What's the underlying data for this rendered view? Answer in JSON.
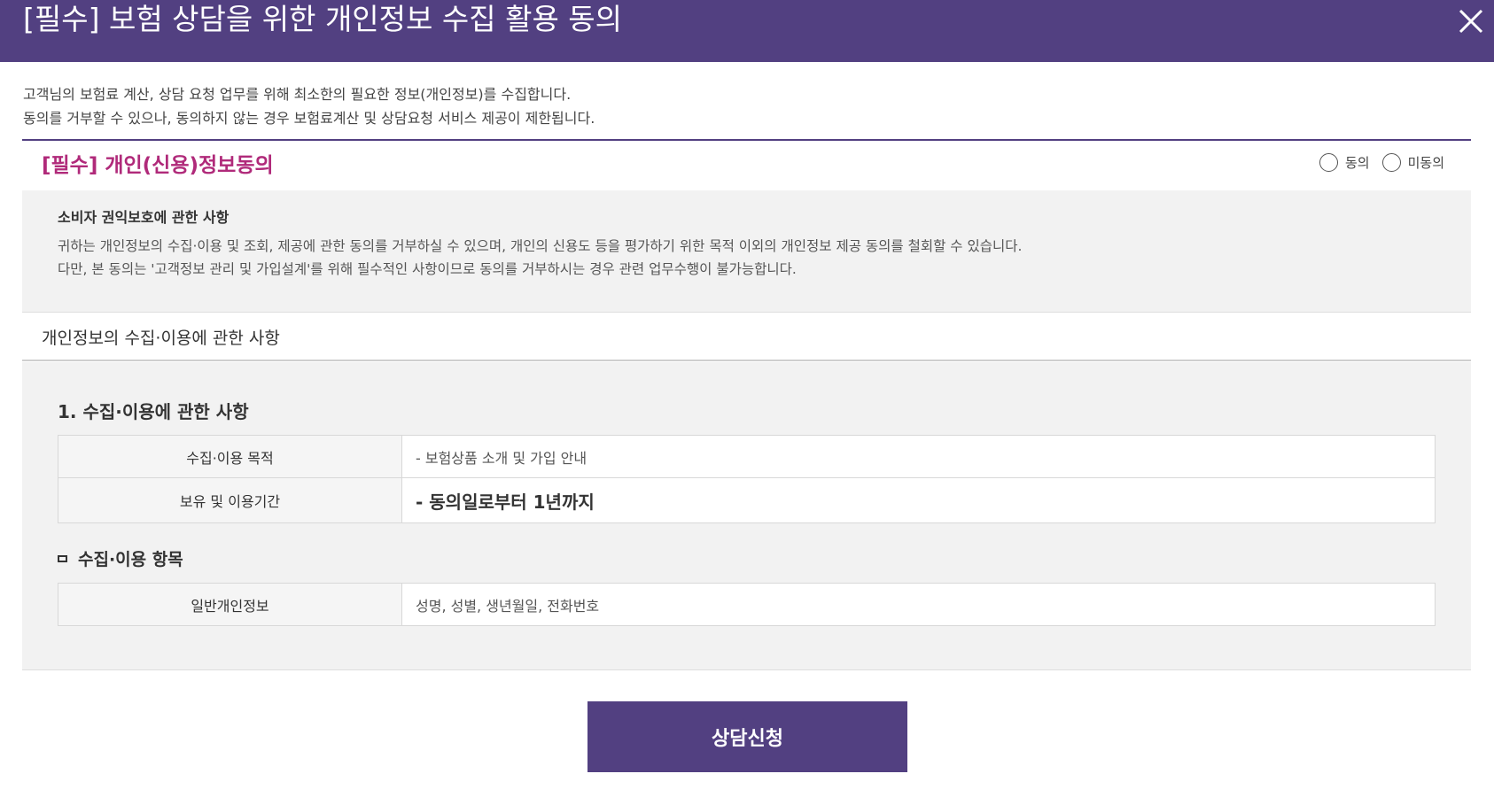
{
  "header": {
    "title": "[필수] 보험 상담을 위한 개인정보 수집 활용 동의",
    "close_icon": "close-icon"
  },
  "intro": {
    "line1": "고객님의 보험료 계산, 상담 요청 업무를 위해 최소한의 필요한 정보(개인정보)를 수집합니다.",
    "line2": "동의를 거부할 수 있으나, 동의하지 않는 경우 보험료계산 및 상담요청 서비스 제공이 제한됩니다."
  },
  "consent": {
    "title": "[필수] 개인(신용)정보동의",
    "agree_label": "동의",
    "disagree_label": "미동의"
  },
  "notice": {
    "title": "소비자 권익보호에 관한 사항",
    "line1": "귀하는 개인정보의 수집·이용 및 조회, 제공에 관한 동의를 거부하실 수 있으며, 개인의 신용도 등을 평가하기 위한 목적 이외의 개인정보 제공 동의를 철회할 수 있습니다.",
    "line2": "다만, 본 동의는 '고객정보 관리 및 가입설계'를 위해 필수적인 사항이므로 동의를 거부하시는 경우 관련 업무수행이 불가능합니다."
  },
  "collect": {
    "heading": "개인정보의 수집·이용에 관한 사항",
    "section_title": "1. 수집·이용에 관한 사항",
    "table1": [
      {
        "label": "수집·이용 목적",
        "value": "- 보험상품 소개 및 가입 안내"
      },
      {
        "label": "보유 및 이용기간",
        "value": "- 동의일로부터 1년까지"
      }
    ],
    "items_title": "수집·이용 항목",
    "table2": [
      {
        "label": "일반개인정보",
        "value": "성명, 성별, 생년월일, 전화번호"
      }
    ]
  },
  "submit_label": "상담신청",
  "colors": {
    "brand": "#524081",
    "accent_title": "#b02a7a"
  }
}
